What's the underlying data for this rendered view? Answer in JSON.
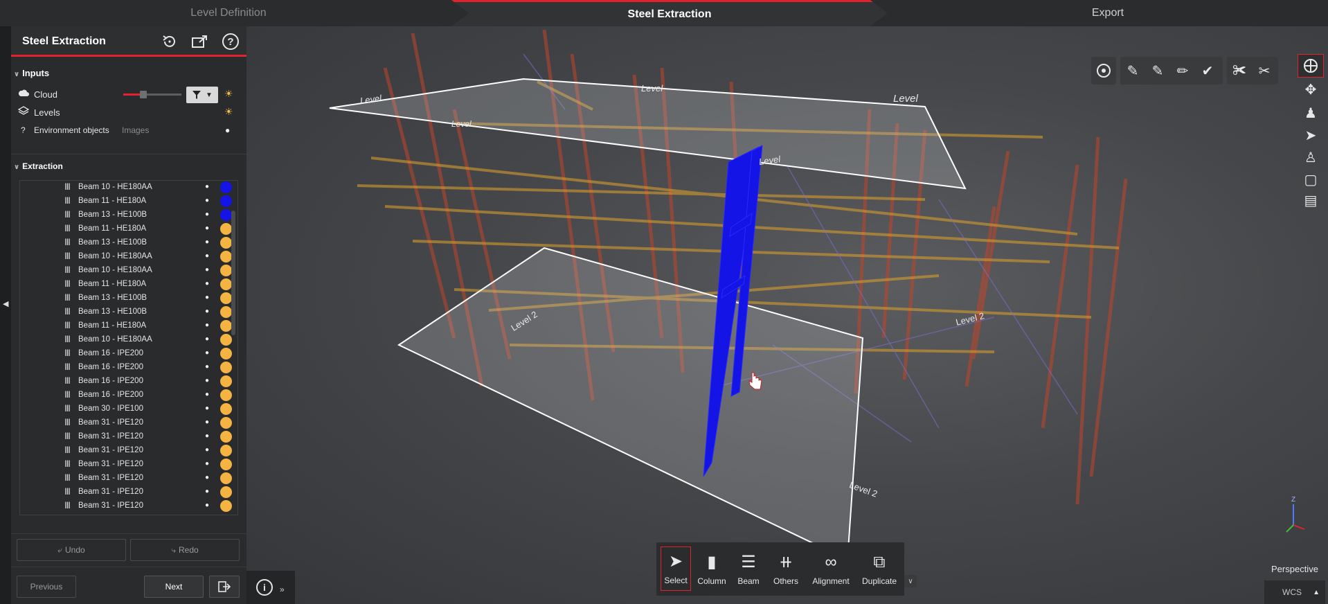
{
  "stepper": {
    "steps": [
      {
        "label": "Level Definition"
      },
      {
        "label": "Steel Extraction"
      },
      {
        "label": "Export"
      }
    ]
  },
  "panel": {
    "title": "Steel Extraction",
    "inputs_label": "Inputs",
    "cloud_label": "Cloud",
    "levels_label": "Levels",
    "env_label": "Environment objects",
    "env_value": "Images",
    "cloud_slider_value": 0.35,
    "extraction_label": "Extraction",
    "beams": [
      {
        "label": "Beam 10 - HE180AA",
        "color": "#1414e6"
      },
      {
        "label": "Beam 11 - HE180A",
        "color": "#1414e6"
      },
      {
        "label": "Beam 13 - HE100B",
        "color": "#1414e6"
      },
      {
        "label": "Beam 11 - HE180A",
        "color": "#f5b342"
      },
      {
        "label": "Beam 13 - HE100B",
        "color": "#f5b342"
      },
      {
        "label": "Beam 10 - HE180AA",
        "color": "#f5b342"
      },
      {
        "label": "Beam 10 - HE180AA",
        "color": "#f5b342"
      },
      {
        "label": "Beam 11 - HE180A",
        "color": "#f5b342"
      },
      {
        "label": "Beam 13 - HE100B",
        "color": "#f5b342"
      },
      {
        "label": "Beam 13 - HE100B",
        "color": "#f5b342"
      },
      {
        "label": "Beam 11 - HE180A",
        "color": "#f5b342"
      },
      {
        "label": "Beam 10 - HE180AA",
        "color": "#f5b342"
      },
      {
        "label": "Beam 16 - IPE200",
        "color": "#f5b342"
      },
      {
        "label": "Beam 16 - IPE200",
        "color": "#f5b342"
      },
      {
        "label": "Beam 16 - IPE200",
        "color": "#f5b342"
      },
      {
        "label": "Beam 16 - IPE200",
        "color": "#f5b342"
      },
      {
        "label": "Beam 30 - IPE100",
        "color": "#f5b342"
      },
      {
        "label": "Beam 31 - IPE120",
        "color": "#f5b342"
      },
      {
        "label": "Beam 31 - IPE120",
        "color": "#f5b342"
      },
      {
        "label": "Beam 31 - IPE120",
        "color": "#f5b342"
      },
      {
        "label": "Beam 31 - IPE120",
        "color": "#f5b342"
      },
      {
        "label": "Beam 31 - IPE120",
        "color": "#f5b342"
      },
      {
        "label": "Beam 31 - IPE120",
        "color": "#f5b342"
      },
      {
        "label": "Beam 31 - IPE120",
        "color": "#f5b342"
      }
    ],
    "undo_label": "Undo",
    "redo_label": "Redo",
    "previous_label": "Previous",
    "next_label": "Next"
  },
  "viewport": {
    "level_labels": {
      "upper": [
        "Level",
        "Level",
        "Level",
        "Level",
        "Level"
      ],
      "lower": [
        "Level 2",
        "Level 2",
        "Level 2"
      ]
    },
    "toolbar": {
      "tools": [
        {
          "label": "Select",
          "icon": "cursor-icon"
        },
        {
          "label": "Column",
          "icon": "column-icon"
        },
        {
          "label": "Beam",
          "icon": "beam-icon"
        },
        {
          "label": "Others",
          "icon": "others-icon"
        },
        {
          "label": "Alignment",
          "icon": "link-icon"
        },
        {
          "label": "Duplicate",
          "icon": "duplicate-icon"
        }
      ]
    },
    "projection_label": "Perspective",
    "coord_system_label": "WCS",
    "axis_label": "Z",
    "colors": {
      "accent": "#e2222f",
      "selected_steel": "#1414e6",
      "extracted_steel": "#f5b342",
      "cloud_red": "#c0452a"
    }
  }
}
